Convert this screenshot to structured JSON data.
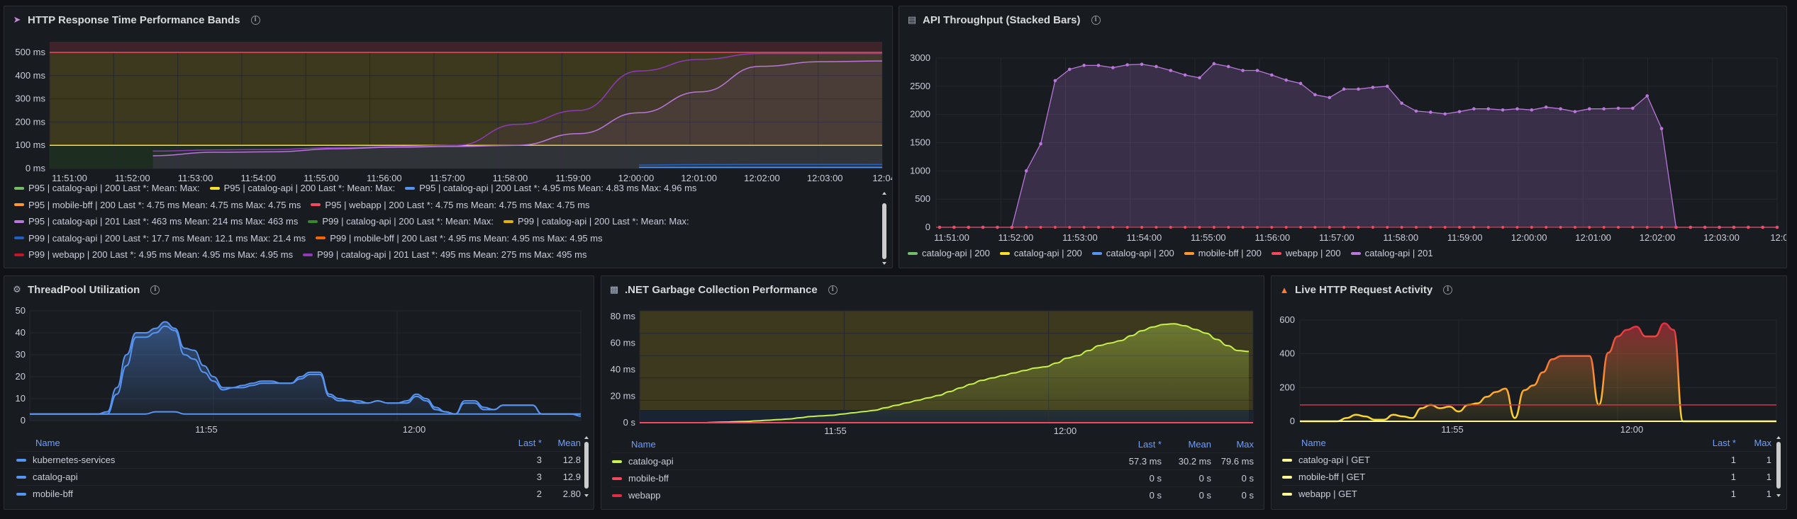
{
  "panels": {
    "http": {
      "title": "HTTP Response Time Performance Bands",
      "icon": "rocket-icon",
      "yticks": [
        "500 ms",
        "400 ms",
        "300 ms",
        "200 ms",
        "100 ms",
        "0 ms"
      ],
      "xticks": [
        "11:51:00",
        "11:52:00",
        "11:53:00",
        "11:54:00",
        "11:55:00",
        "11:56:00",
        "11:57:00",
        "11:58:00",
        "11:59:00",
        "12:00:00",
        "12:01:00",
        "12:02:00",
        "12:03:00",
        "12:04:0"
      ],
      "legend_rows": [
        [
          {
            "color": "#73bf69",
            "text": "P95 | catalog-api | 200   Last *:   Mean:   Max:"
          },
          {
            "color": "#fade2a",
            "text": "P95 | catalog-api | 200   Last *:   Mean:   Max:"
          },
          {
            "color": "#5794f2",
            "text": "P95 | catalog-api | 200   Last *: 4.95 ms   Mean: 4.83 ms   Max: 4.96 ms"
          }
        ],
        [
          {
            "color": "#ff9830",
            "text": "P95 | mobile-bff | 200   Last *: 4.75 ms   Mean: 4.75 ms   Max: 4.75 ms"
          },
          {
            "color": "#f2495c",
            "text": "P95 | webapp | 200   Last *: 4.75 ms   Mean: 4.75 ms   Max: 4.75 ms"
          }
        ],
        [
          {
            "color": "#b877d9",
            "text": "P95 | catalog-api | 201   Last *: 463 ms   Mean: 214 ms   Max: 463 ms"
          },
          {
            "color": "#37872d",
            "text": "P99 | catalog-api | 200   Last *:   Mean:   Max:"
          },
          {
            "color": "#e0b400",
            "text": "P99 | catalog-api | 200   Last *:   Mean:   Max:"
          }
        ],
        [
          {
            "color": "#1f60c4",
            "text": "P99 | catalog-api | 200   Last *: 17.7 ms   Mean: 12.1 ms   Max: 21.4 ms"
          },
          {
            "color": "#fa6400",
            "text": "P99 | mobile-bff | 200   Last *: 4.95 ms   Mean: 4.95 ms   Max: 4.95 ms"
          }
        ],
        [
          {
            "color": "#c4162a",
            "text": "P99 | webapp | 200   Last *: 4.95 ms   Mean: 4.95 ms   Max: 4.95 ms"
          },
          {
            "color": "#8f3bb8",
            "text": "P99 | catalog-api | 201   Last *: 495 ms   Mean: 275 ms   Max: 495 ms"
          }
        ]
      ]
    },
    "throughput": {
      "title": "API Throughput (Stacked Bars)",
      "icon": "chart-increasing-icon",
      "yticks": [
        "3000",
        "2500",
        "2000",
        "1500",
        "1000",
        "500",
        "0"
      ],
      "xticks": [
        "11:51:00",
        "11:52:00",
        "11:53:00",
        "11:54:00",
        "11:55:00",
        "11:56:00",
        "11:57:00",
        "11:58:00",
        "11:59:00",
        "12:00:00",
        "12:01:00",
        "12:02:00",
        "12:03:00",
        "12:04:0"
      ],
      "legend": [
        {
          "color": "#73bf69",
          "text": "catalog-api | 200"
        },
        {
          "color": "#fade2a",
          "text": "catalog-api | 200"
        },
        {
          "color": "#5794f2",
          "text": "catalog-api | 200"
        },
        {
          "color": "#ff9830",
          "text": "mobile-bff | 200"
        },
        {
          "color": "#f2495c",
          "text": "webapp | 200"
        },
        {
          "color": "#b877d9",
          "text": "catalog-api | 201"
        }
      ]
    },
    "threadpool": {
      "title": "ThreadPool Utilization",
      "yticks": [
        "50",
        "40",
        "30",
        "20",
        "10",
        "0"
      ],
      "xticks": [
        "11:55",
        "12:00"
      ],
      "headers": {
        "name": "Name",
        "last": "Last *",
        "mean": "Mean"
      },
      "rows": [
        {
          "color": "#5794f2",
          "name": "kubernetes-services",
          "last": "3",
          "mean": "12.8"
        },
        {
          "color": "#5794f2",
          "name": "catalog-api",
          "last": "3",
          "mean": "12.9"
        },
        {
          "color": "#5794f2",
          "name": "mobile-bff",
          "last": "2",
          "mean": "2.80"
        }
      ]
    },
    "gc": {
      "title": ".NET Garbage Collection Performance",
      "icon": "trash-icon",
      "yticks": [
        "80 ms",
        "60 ms",
        "40 ms",
        "20 ms",
        "0 s"
      ],
      "xticks": [
        "11:55",
        "12:00"
      ],
      "headers": {
        "name": "Name",
        "last": "Last *",
        "mean": "Mean",
        "max": "Max"
      },
      "rows": [
        {
          "color": "#c8f14d",
          "name": "catalog-api",
          "last": "57.3 ms",
          "mean": "30.2 ms",
          "max": "79.6 ms"
        },
        {
          "color": "#f2495c",
          "name": "mobile-bff",
          "last": "0 s",
          "mean": "0 s",
          "max": "0 s"
        },
        {
          "color": "#e02f44",
          "name": "webapp",
          "last": "0 s",
          "mean": "0 s",
          "max": "0 s"
        }
      ]
    },
    "live": {
      "title": "Live HTTP Request Activity",
      "icon": "fire-icon",
      "yticks": [
        "600",
        "400",
        "200",
        "0"
      ],
      "xticks": [
        "11:55",
        "12:00"
      ],
      "headers": {
        "name": "Name",
        "last": "Last *",
        "max": "Max"
      },
      "rows": [
        {
          "color": "#fff899",
          "name": "catalog-api | GET",
          "last": "1",
          "max": "1"
        },
        {
          "color": "#fff899",
          "name": "mobile-bff | GET",
          "last": "1",
          "max": "1"
        },
        {
          "color": "#fff899",
          "name": "webapp | GET",
          "last": "1",
          "max": "1"
        }
      ]
    }
  },
  "chart_data": [
    {
      "type": "line",
      "title": "HTTP Response Time Performance Bands",
      "ylim": [
        0,
        500
      ],
      "x": [
        "11:51:00",
        "11:52:00",
        "11:53:00",
        "11:54:00",
        "11:55:00",
        "11:56:00",
        "11:57:00",
        "11:58:00",
        "11:59:00",
        "12:00:00",
        "12:01:00",
        "12:02:00",
        "12:03:00",
        "12:04:00"
      ],
      "series": [
        {
          "name": "P99 | catalog-api | 201",
          "color": "#8f3bb8",
          "values": [
            null,
            75,
            80,
            82,
            90,
            95,
            100,
            190,
            250,
            420,
            470,
            495,
            495,
            495
          ]
        },
        {
          "name": "P95 | catalog-api | 201",
          "color": "#b877d9",
          "values": [
            null,
            55,
            70,
            72,
            85,
            92,
            95,
            100,
            150,
            240,
            330,
            440,
            460,
            463
          ]
        },
        {
          "name": "P99 | catalog-api | 200",
          "color": "#1f60c4",
          "values": [
            null,
            null,
            null,
            null,
            null,
            null,
            null,
            null,
            null,
            15,
            17,
            18,
            18,
            17.7
          ]
        },
        {
          "name": "P95 | catalog-api | 200",
          "color": "#5794f2",
          "values": [
            null,
            null,
            null,
            null,
            null,
            null,
            null,
            null,
            null,
            5,
            5,
            5,
            5,
            4.95
          ]
        }
      ],
      "thresholds": [
        {
          "value": 500,
          "color": "#f2495c"
        },
        {
          "value": 100,
          "color": "#fade2a"
        }
      ]
    },
    {
      "type": "area",
      "title": "API Throughput (Stacked Bars)",
      "ylim": [
        0,
        3200
      ],
      "x": [
        "11:51:00",
        "11:52:00",
        "11:53:00",
        "11:54:00",
        "11:55:00",
        "11:56:00",
        "11:57:00",
        "11:58:00",
        "11:59:00",
        "12:00:00",
        "12:01:00",
        "12:02:00",
        "12:03:00",
        "12:04:00"
      ],
      "series": [
        {
          "name": "catalog-api | 201",
          "color": "#b877d9",
          "values": [
            0,
            0,
            2800,
            2880,
            2700,
            2800,
            2400,
            2500,
            2050,
            2100,
            2100,
            2150,
            0,
            0
          ]
        },
        {
          "name": "webapp | 200",
          "color": "#f2495c",
          "values": [
            0,
            0,
            0,
            0,
            0,
            0,
            0,
            0,
            0,
            0,
            0,
            0,
            0,
            0
          ]
        }
      ]
    },
    {
      "type": "line",
      "title": "ThreadPool Utilization",
      "ylim": [
        0,
        50
      ],
      "x": [
        "11:51",
        "11:52",
        "11:53",
        "11:54",
        "11:55",
        "11:56",
        "11:57",
        "11:58",
        "11:59",
        "12:00",
        "12:01",
        "12:02",
        "12:03"
      ],
      "series": [
        {
          "name": "kubernetes-services",
          "values": [
            3,
            3,
            40,
            45,
            15,
            17,
            20,
            10,
            6,
            8,
            3,
            7,
            3
          ]
        },
        {
          "name": "catalog-api",
          "values": [
            3,
            3,
            38,
            43,
            14,
            17,
            21,
            9,
            6,
            8,
            3,
            8,
            3
          ]
        },
        {
          "name": "mobile-bff",
          "values": [
            3,
            3,
            3,
            4,
            3,
            3,
            3,
            3,
            3,
            3,
            3,
            3,
            2
          ]
        }
      ]
    },
    {
      "type": "line",
      "title": ".NET Garbage Collection Performance",
      "ylim": [
        0,
        90
      ],
      "x": [
        "11:51",
        "11:52",
        "11:53",
        "11:54",
        "11:55",
        "11:56",
        "11:57",
        "11:58",
        "11:59",
        "12:00",
        "12:01",
        "12:02",
        "12:03"
      ],
      "series": [
        {
          "name": "catalog-api",
          "values": [
            0,
            0,
            1,
            3,
            6,
            10,
            18,
            30,
            42,
            55,
            70,
            79,
            57.3
          ]
        },
        {
          "name": "mobile-bff",
          "values": [
            0,
            0,
            0,
            0,
            0,
            0,
            0,
            0,
            0,
            0,
            0,
            0,
            0
          ]
        },
        {
          "name": "webapp",
          "values": [
            0,
            0,
            0,
            0,
            0,
            0,
            0,
            0,
            0,
            0,
            0,
            0,
            0
          ]
        }
      ]
    },
    {
      "type": "line",
      "title": "Live HTTP Request Activity",
      "ylim": [
        0,
        650
      ],
      "x": [
        "11:51",
        "11:52",
        "11:53",
        "11:54",
        "11:55",
        "11:56",
        "11:57",
        "11:58",
        "11:59",
        "12:00",
        "12:01",
        "12:02",
        "12:03"
      ],
      "series": [
        {
          "name": "catalog-api | GET",
          "values": [
            0,
            30,
            20,
            60,
            100,
            100,
            200,
            50,
            400,
            400,
            150,
            600,
            0
          ]
        },
        {
          "name": "mobile-bff | GET",
          "values": [
            0,
            0,
            0,
            0,
            0,
            0,
            0,
            0,
            0,
            0,
            0,
            0,
            0
          ]
        },
        {
          "name": "webapp | GET",
          "values": [
            0,
            0,
            0,
            0,
            0,
            0,
            0,
            0,
            0,
            0,
            0,
            0,
            0
          ]
        }
      ],
      "thresholds": [
        {
          "value": 100,
          "color": "#e02f44"
        }
      ]
    }
  ]
}
